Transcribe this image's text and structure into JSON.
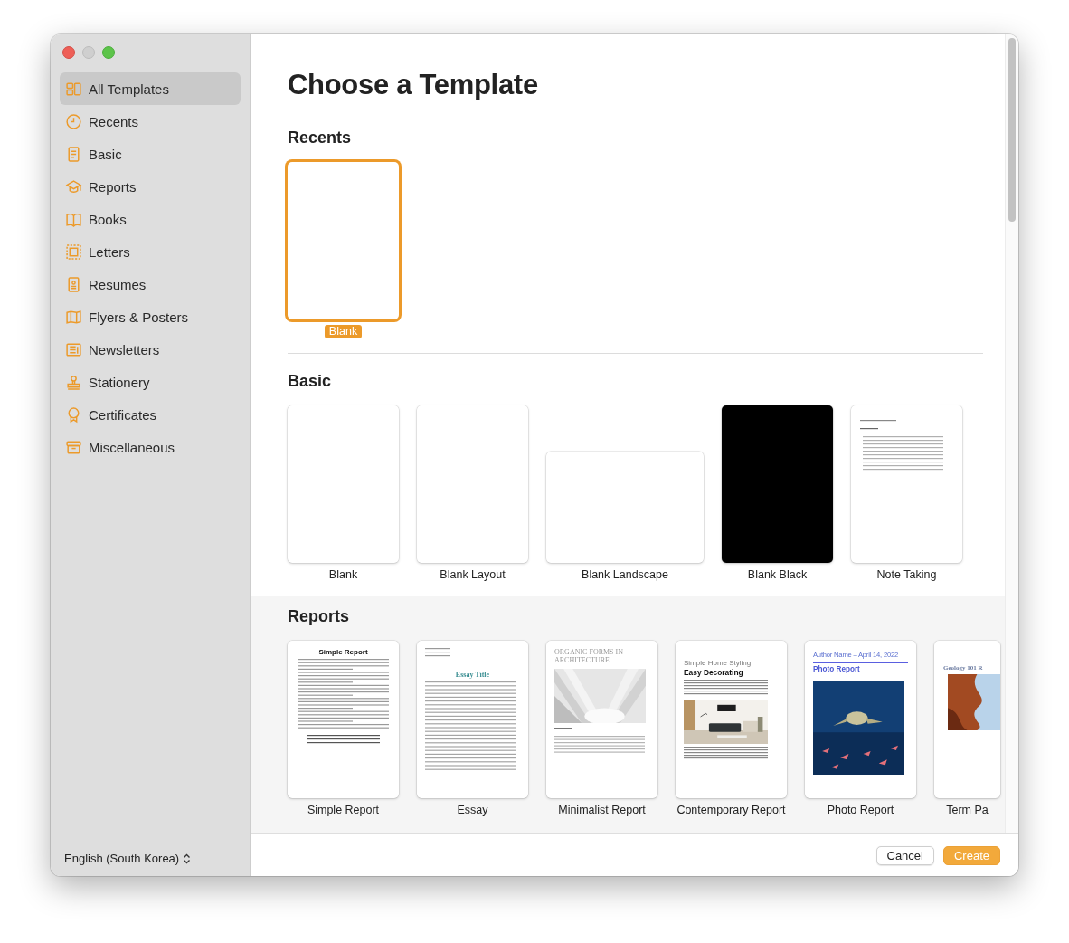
{
  "sidebar": {
    "items": [
      {
        "label": "All Templates",
        "selected": true
      },
      {
        "label": "Recents",
        "selected": false
      },
      {
        "label": "Basic",
        "selected": false
      },
      {
        "label": "Reports",
        "selected": false
      },
      {
        "label": "Books",
        "selected": false
      },
      {
        "label": "Letters",
        "selected": false
      },
      {
        "label": "Resumes",
        "selected": false
      },
      {
        "label": "Flyers & Posters",
        "selected": false
      },
      {
        "label": "Newsletters",
        "selected": false
      },
      {
        "label": "Stationery",
        "selected": false
      },
      {
        "label": "Certificates",
        "selected": false
      },
      {
        "label": "Miscellaneous",
        "selected": false
      }
    ],
    "language": "English (South Korea)"
  },
  "main": {
    "title": "Choose a Template",
    "sections": [
      {
        "heading": "Recents",
        "templates": [
          {
            "name": "Blank",
            "kind": "blank",
            "selected": true
          }
        ]
      },
      {
        "heading": "Basic",
        "templates": [
          {
            "name": "Blank",
            "kind": "blank",
            "selected": false
          },
          {
            "name": "Blank Layout",
            "kind": "blank",
            "selected": false
          },
          {
            "name": "Blank Landscape",
            "kind": "landscape",
            "selected": false
          },
          {
            "name": "Blank Black",
            "kind": "black",
            "selected": false
          },
          {
            "name": "Note Taking",
            "kind": "notes",
            "selected": false
          }
        ]
      },
      {
        "heading": "Reports",
        "templates": [
          {
            "name": "Simple Report",
            "kind": "simple",
            "selected": false,
            "preview_texts": [
              "Simple Report"
            ]
          },
          {
            "name": "Essay",
            "kind": "essay",
            "selected": false,
            "preview_texts": [
              "Essay Title"
            ]
          },
          {
            "name": "Minimalist Report",
            "kind": "minimalist",
            "selected": false,
            "preview_texts": [
              "ORGANIC FORMS IN ARCHITECTURE"
            ]
          },
          {
            "name": "Contemporary Report",
            "kind": "contemporary",
            "selected": false,
            "preview_texts": [
              "Simple Home Styling",
              "Easy Decorating"
            ]
          },
          {
            "name": "Photo Report",
            "selected": false,
            "preview_texts": [
              "Author Name – April 14, 2022",
              "Photo Report"
            ]
          },
          {
            "name": "Term Pa",
            "kind": "term",
            "selected": false,
            "preview_texts": [
              "Geology 101 R"
            ]
          }
        ]
      }
    ]
  },
  "buttons": [
    {
      "label": "Cancel",
      "kind": "secondary"
    },
    {
      "label": "Create",
      "kind": "primary"
    }
  ]
}
